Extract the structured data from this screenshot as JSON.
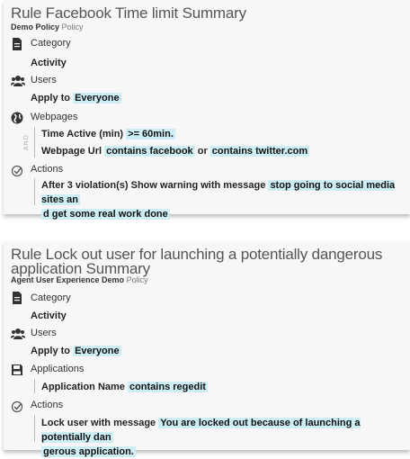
{
  "rule1": {
    "title": "Rule Facebook Time limit Summary",
    "policy_name": "Demo Policy",
    "policy_suffix": "Policy",
    "category_label": "Category",
    "category_value": "Activity",
    "users_label": "Users",
    "users_prefix": "Apply to",
    "users_value": "Everyone",
    "webpages_label": "Webpages",
    "and_label": "AND",
    "cond1_field": "Time Active (min)",
    "cond1_value": ">=  60min.",
    "cond2_field": "Webpage Url",
    "cond2_op1": "contains facebook",
    "cond2_or": "or",
    "cond2_op2": "contains twitter.com",
    "actions_label": "Actions",
    "action_prefix": "After 3 violation(s) Show warning with message",
    "action_msg_line1": "stop going to social media sites an",
    "action_msg_line2": "d get some real work done"
  },
  "rule2": {
    "title_line1": "Rule Lock out user for launching a potentially dangerous",
    "title_line2": "application Summary",
    "policy_name": "Agent User Experience Demo",
    "policy_suffix": "Policy",
    "category_label": "Category",
    "category_value": "Activity",
    "users_label": "Users",
    "users_prefix": "Apply to",
    "users_value": "Everyone",
    "applications_label": "Applications",
    "app_field": "Application Name",
    "app_value": "contains regedit",
    "actions_label": "Actions",
    "action_prefix": "Lock user with message",
    "action_msg_line1": "You are locked out because of launching a potentially dan",
    "action_msg_line2": "gerous application."
  },
  "icons": {
    "category": "document-icon",
    "users": "users-icon",
    "webpages": "globe-icon",
    "applications": "floppy-icon",
    "actions": "check-circle-icon"
  },
  "colors": {
    "highlight": "#cdeef5",
    "card_bg": "#f7f7f7"
  }
}
